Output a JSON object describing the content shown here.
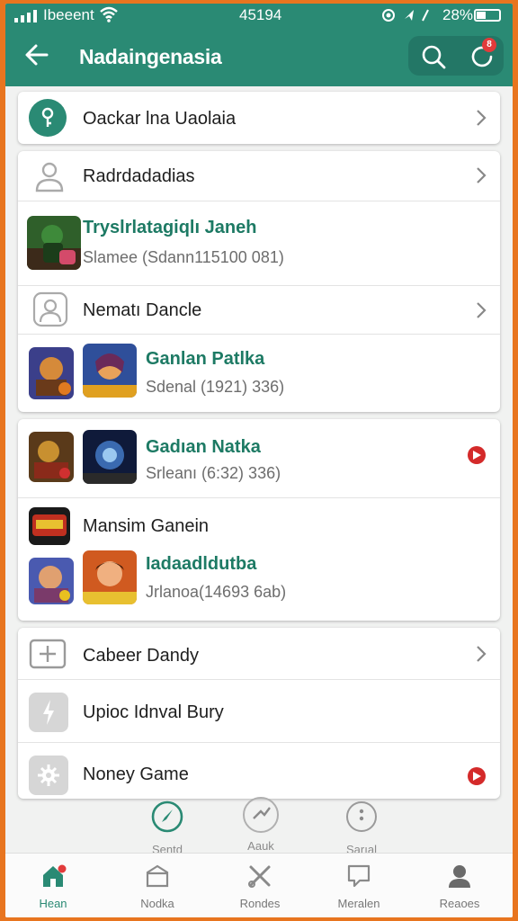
{
  "status": {
    "carrier": "Ibeeent",
    "time": "45194",
    "battery": "28%"
  },
  "appbar": {
    "title": "Nadaingenasia"
  },
  "badge_count": "8",
  "card1": {
    "row1": {
      "label": "Oackar lna Uaolaia"
    }
  },
  "card2": {
    "row1": {
      "label": "Radrdadadias"
    },
    "row2": {
      "title": "Tryslrlatagiqlı Janeh",
      "subtitle": "Slamee (Sdann115100 081)"
    },
    "row3": {
      "label": "Nematı Dancle"
    },
    "row4": {
      "title": "Ganlan Patlka",
      "subtitle": "Sdenal (1921) 336)"
    }
  },
  "card3": {
    "row1": {
      "title": "Gadıan Natka",
      "subtitle": "Srleanı (6:32) 336)"
    },
    "row2": {
      "label": "Mansim Ganein"
    },
    "row3": {
      "title": "Iadaadldutba",
      "subtitle": "Jrlanoa(14693 6ab)"
    }
  },
  "card4": {
    "row1": {
      "label": "Cabeer Dandy"
    },
    "row2": {
      "label": "Upioc Idnval Bury"
    },
    "row3": {
      "label": "Noney Game"
    }
  },
  "quick_actions": [
    {
      "label": "Sentd"
    },
    {
      "label": "Aauk"
    },
    {
      "label": "Sarıal"
    }
  ],
  "bottom_nav": [
    {
      "label": "Hean",
      "active": true
    },
    {
      "label": "Nodka"
    },
    {
      "label": "Rondes"
    },
    {
      "label": "Meralen"
    },
    {
      "label": "Reaoes"
    }
  ],
  "colors": {
    "primary": "#2a8a74",
    "accent_red": "#d42a2a",
    "frame": "#e8751f"
  }
}
